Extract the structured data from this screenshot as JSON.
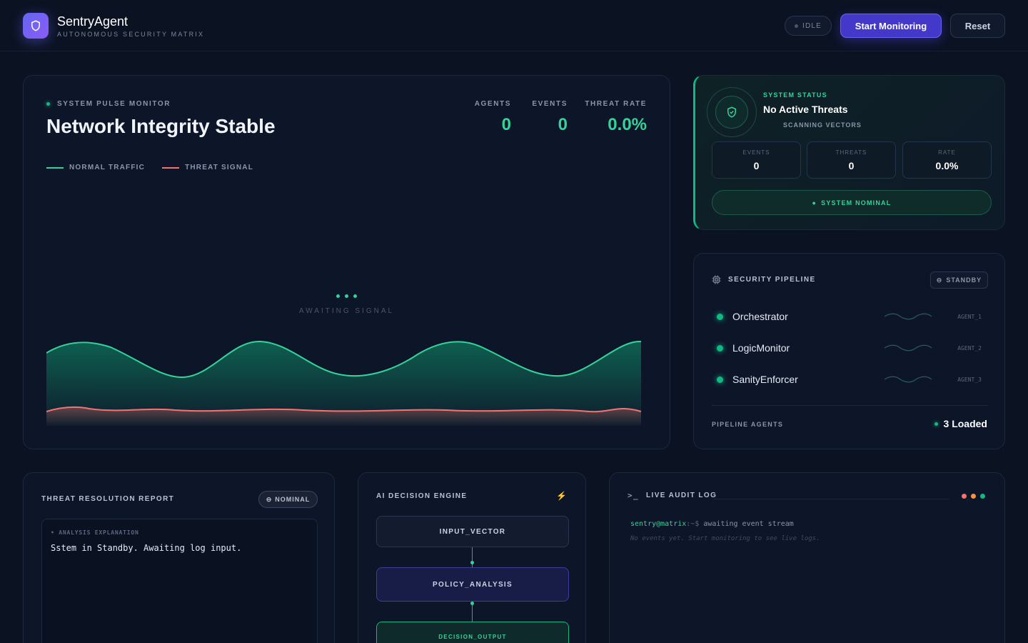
{
  "header": {
    "brand_title": "SentryAgent",
    "brand_subtitle": "AUTONOMOUS SECURITY MATRIX",
    "status_pill": "IDLE",
    "start_button": "Start Monitoring",
    "reset_button": "Reset",
    "logo_icon": "shield-icon"
  },
  "pulse": {
    "eyebrow": "SYSTEM PULSE MONITOR",
    "title": "Network Integrity Stable",
    "stats": [
      {
        "label": "AGENTS",
        "value": "0"
      },
      {
        "label": "EVENTS",
        "value": "0"
      },
      {
        "label": "THREAT RATE",
        "value": "0.0%"
      }
    ],
    "legend": [
      {
        "label": "NORMAL TRAFFIC",
        "color": "#34d399"
      },
      {
        "label": "THREAT SIGNAL",
        "color": "#f87171"
      }
    ],
    "awaiting": "AWAITING SIGNAL"
  },
  "status": {
    "eyebrow": "SYSTEM STATUS",
    "title": "No Active Threats",
    "subtitle": "SCANNING VECTORS",
    "metrics": [
      {
        "label": "EVENTS",
        "value": "0"
      },
      {
        "label": "THREATS",
        "value": "0"
      },
      {
        "label": "RATE",
        "value": "0.0%"
      }
    ],
    "nominal": "SYSTEM NOMINAL",
    "accent": "#10b981"
  },
  "pipeline": {
    "title": "SECURITY PIPELINE",
    "badge": "STANDBY",
    "agents": [
      {
        "name": "Orchestrator",
        "tag": "AGENT_1"
      },
      {
        "name": "LogicMonitor",
        "tag": "AGENT_2"
      },
      {
        "name": "SanityEnforcer",
        "tag": "AGENT_3"
      }
    ],
    "footer_label": "PIPELINE AGENTS",
    "footer_value": "3 Loaded"
  },
  "report": {
    "title": "THREAT RESOLUTION REPORT",
    "badge": "NOMINAL",
    "analysis_label": "ANALYSIS EXPLANATION",
    "analysis_text": "Sstem in Standby. Awaiting log input."
  },
  "ai": {
    "title": "AI DECISION ENGINE",
    "nodes": [
      "INPUT_VECTOR",
      "POLICY_ANALYSIS",
      "DECISION_OUTPUT"
    ]
  },
  "audit": {
    "title": "LIVE AUDIT LOG",
    "prompt_user": "sentry@matrix",
    "prompt_path": ":~$",
    "prompt_text": "awaiting event stream",
    "empty_text": "No events yet. Start monitoring to see live logs.",
    "dot_colors": [
      "#f87171",
      "#fb923c",
      "#10b981"
    ]
  }
}
